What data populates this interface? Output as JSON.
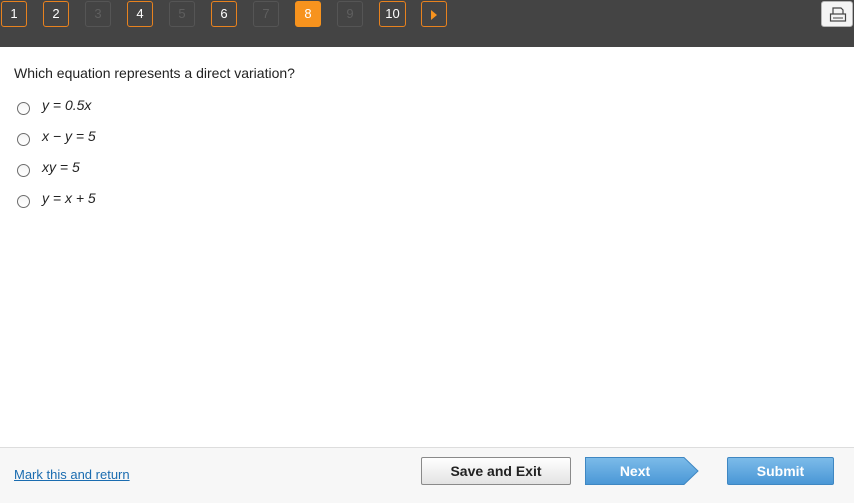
{
  "pagination": {
    "pages": [
      {
        "label": "1",
        "state": "link"
      },
      {
        "label": "2",
        "state": "link"
      },
      {
        "label": "3",
        "state": "disabled"
      },
      {
        "label": "4",
        "state": "link"
      },
      {
        "label": "5",
        "state": "disabled"
      },
      {
        "label": "6",
        "state": "link"
      },
      {
        "label": "7",
        "state": "disabled"
      },
      {
        "label": "8",
        "state": "current"
      },
      {
        "label": "9",
        "state": "disabled"
      },
      {
        "label": "10",
        "state": "link"
      }
    ],
    "next_icon": "play-triangle-icon",
    "print_icon": "printer-icon",
    "accent_color": "#f7931e"
  },
  "question": {
    "text": "Which equation represents a direct variation?",
    "choices": [
      {
        "label": "y = 0.5x"
      },
      {
        "label": "x − y = 5"
      },
      {
        "label": "xy = 5"
      },
      {
        "label": "y = x + 5"
      }
    ]
  },
  "footer": {
    "mark_link": "Mark this and return",
    "save_exit": "Save and Exit",
    "next": "Next",
    "submit": "Submit"
  }
}
